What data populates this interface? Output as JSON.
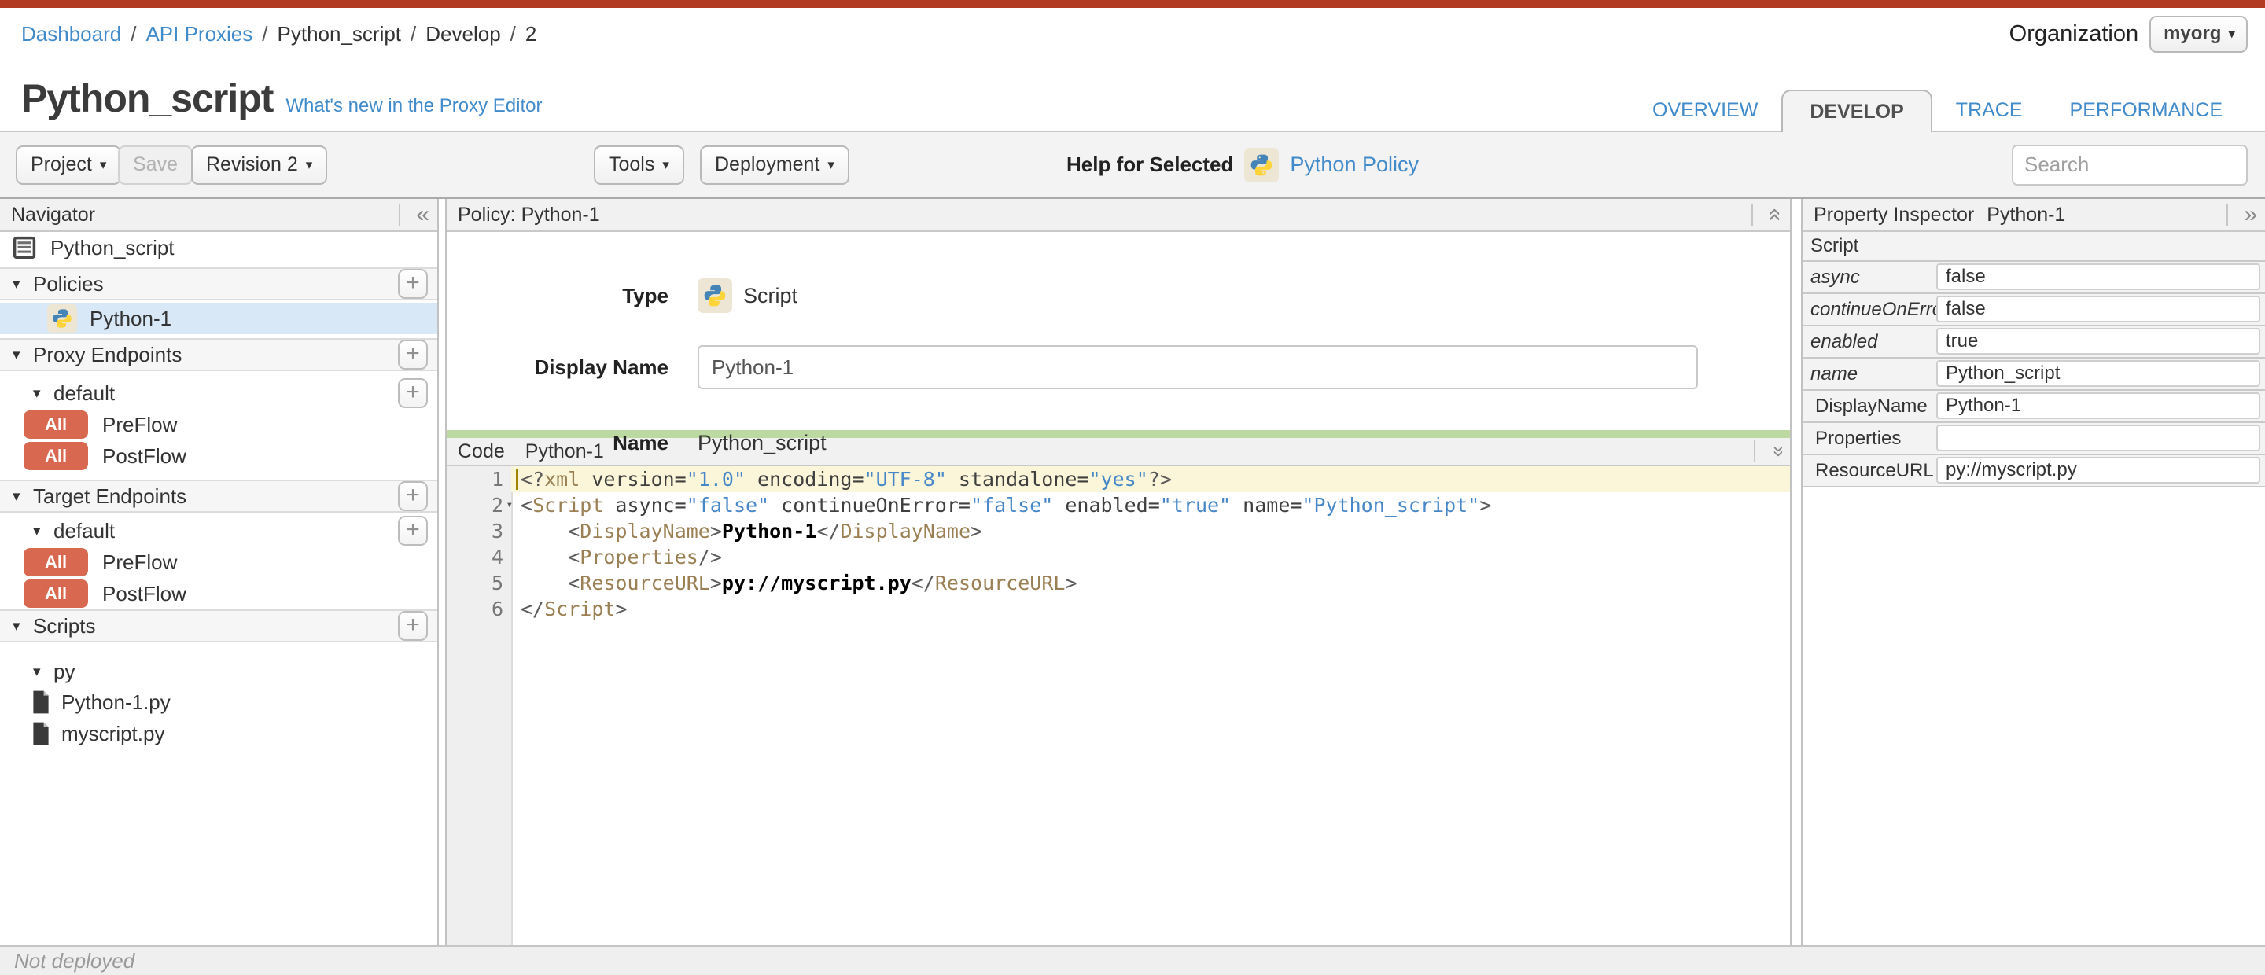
{
  "breadcrumb": {
    "separator": "/",
    "items": [
      "Dashboard",
      "API Proxies",
      "Python_script",
      "Develop",
      "2"
    ]
  },
  "organization": {
    "label": "Organization",
    "selected": "myorg"
  },
  "page": {
    "title": "Python_script",
    "whats_new_link": "What's new in the Proxy Editor"
  },
  "tabs": [
    {
      "label": "OVERVIEW"
    },
    {
      "label": "DEVELOP"
    },
    {
      "label": "TRACE"
    },
    {
      "label": "PERFORMANCE"
    }
  ],
  "toolbar": {
    "project_label": "Project",
    "save_label": "Save",
    "revision_label": "Revision 2",
    "tools_label": "Tools",
    "deployment_label": "Deployment",
    "help_for_selected": "Help for Selected",
    "help_link": "Python Policy",
    "search_placeholder": "Search"
  },
  "icons": {
    "caret_down": "▾",
    "collapse_left": "«",
    "collapse_right": "»",
    "double_chevron": "«",
    "plus": "+"
  },
  "navigator": {
    "title": "Navigator",
    "rows": [
      {
        "type": "item",
        "label": "Python_script"
      },
      {
        "type": "section",
        "label": "Policies"
      },
      {
        "type": "policy",
        "label": "Python-1",
        "selected": true
      },
      {
        "type": "section",
        "label": "Proxy Endpoints"
      },
      {
        "type": "subsection",
        "label": "default"
      },
      {
        "type": "flow",
        "badge": "All",
        "label": "PreFlow"
      },
      {
        "type": "flow",
        "badge": "All",
        "label": "PostFlow"
      },
      {
        "type": "section",
        "label": "Target Endpoints"
      },
      {
        "type": "subsection",
        "label": "default"
      },
      {
        "type": "flow",
        "badge": "All",
        "label": "PreFlow"
      },
      {
        "type": "flow",
        "badge": "All",
        "label": "PostFlow"
      },
      {
        "type": "section",
        "label": "Scripts"
      },
      {
        "type": "subsection",
        "label": "py"
      },
      {
        "type": "file",
        "label": "Python-1.py"
      },
      {
        "type": "file",
        "label": "myscript.py"
      }
    ]
  },
  "policy_panel": {
    "header": "Policy: Python-1",
    "type_label": "Type",
    "type_value": "Script",
    "display_name_label": "Display Name",
    "display_name_value": "Python-1",
    "name_label": "Name",
    "name_value": "Python_script"
  },
  "code_panel": {
    "header_label": "Code",
    "header_name": "Python-1",
    "lines": [
      {
        "num": "1",
        "active": true,
        "tokens": [
          [
            "b",
            "<?"
          ],
          [
            "tag",
            "xml"
          ],
          [
            "attr",
            " version="
          ],
          [
            "val",
            "\"1.0\""
          ],
          [
            "attr",
            " encoding="
          ],
          [
            "val",
            "\"UTF-8\""
          ],
          [
            "attr",
            " standalone="
          ],
          [
            "val",
            "\"yes\""
          ],
          [
            "b",
            "?>"
          ]
        ]
      },
      {
        "num": "2",
        "fold": true,
        "tokens": [
          [
            "b",
            "<"
          ],
          [
            "tag",
            "Script"
          ],
          [
            "attr",
            " async="
          ],
          [
            "val",
            "\"false\""
          ],
          [
            "attr",
            " continueOnError="
          ],
          [
            "val",
            "\"false\""
          ],
          [
            "attr",
            " enabled="
          ],
          [
            "val",
            "\"true\""
          ],
          [
            "attr",
            " name="
          ],
          [
            "val",
            "\"Python_script\""
          ],
          [
            "b",
            ">"
          ]
        ]
      },
      {
        "num": "3",
        "tokens": [
          [
            "plain",
            "    "
          ],
          [
            "b",
            "<"
          ],
          [
            "tag",
            "DisplayName"
          ],
          [
            "b",
            ">"
          ],
          [
            "txt",
            "Python-1"
          ],
          [
            "b",
            "</"
          ],
          [
            "tag",
            "DisplayName"
          ],
          [
            "b",
            ">"
          ]
        ]
      },
      {
        "num": "4",
        "tokens": [
          [
            "plain",
            "    "
          ],
          [
            "b",
            "<"
          ],
          [
            "tag",
            "Properties"
          ],
          [
            "b",
            "/>"
          ]
        ]
      },
      {
        "num": "5",
        "tokens": [
          [
            "plain",
            "    "
          ],
          [
            "b",
            "<"
          ],
          [
            "tag",
            "ResourceURL"
          ],
          [
            "b",
            ">"
          ],
          [
            "txt",
            "py://myscript.py"
          ],
          [
            "b",
            "</"
          ],
          [
            "tag",
            "ResourceURL"
          ],
          [
            "b",
            ">"
          ]
        ]
      },
      {
        "num": "6",
        "tokens": [
          [
            "b",
            "</"
          ],
          [
            "tag",
            "Script"
          ],
          [
            "b",
            ">"
          ]
        ]
      }
    ]
  },
  "inspector": {
    "header": "Property Inspector",
    "header_name": "Python-1",
    "section": "Script",
    "rows": [
      {
        "label": "async",
        "value": "false",
        "attribute": true
      },
      {
        "label": "continueOnError",
        "value": "false",
        "attribute": true
      },
      {
        "label": "enabled",
        "value": "true",
        "attribute": true
      },
      {
        "label": "name",
        "value": "Python_script",
        "attribute": true
      },
      {
        "label": "DisplayName",
        "value": "Python-1",
        "attribute": false
      },
      {
        "label": "Properties",
        "value": "",
        "attribute": false
      },
      {
        "label": "ResourceURL",
        "value": "py://myscript.py",
        "attribute": false
      }
    ]
  },
  "status_bar": {
    "text": "Not deployed"
  },
  "colors": {
    "accent_red": "#B13B23",
    "link_blue": "#428BCA",
    "selected_row": "#D9E8F7",
    "flow_badge": "#D8684F",
    "green_bar": "#BCD9A2",
    "active_line": "#FBF6D9",
    "code_tag": "#9A8054",
    "code_value": "#4787C8"
  }
}
